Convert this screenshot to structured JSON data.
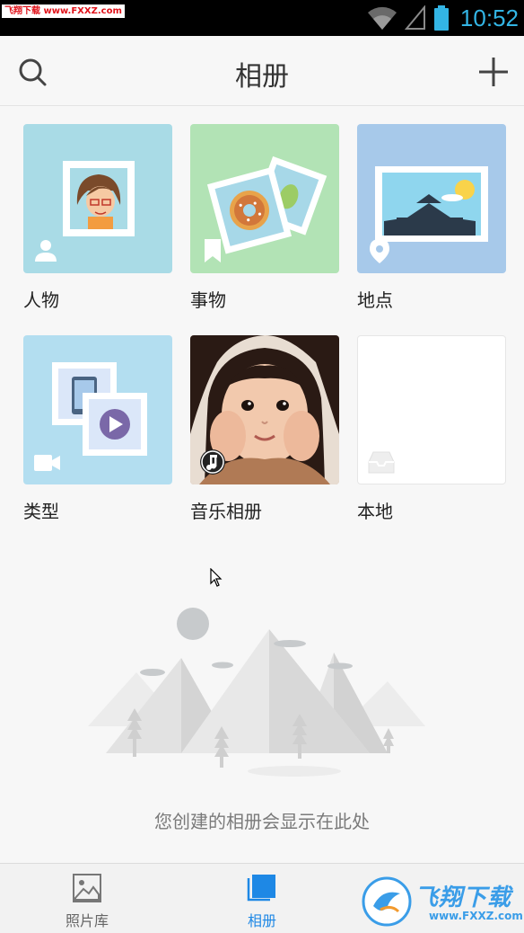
{
  "status_bar": {
    "watermark": "飞翔下载 www.FXXZ.com",
    "time": "10:52",
    "icons": [
      "wifi-icon",
      "signal-icon",
      "battery-icon"
    ]
  },
  "header": {
    "title": "相册",
    "search_icon": "search-icon",
    "add_icon": "plus-icon"
  },
  "albums": [
    {
      "label": "人物",
      "bg": "#a9dbe6",
      "badge_icon": "person-icon"
    },
    {
      "label": "事物",
      "bg": "#b2e3b5",
      "badge_icon": "bookmark-icon"
    },
    {
      "label": "地点",
      "bg": "#a7c9ea",
      "badge_icon": "location-pin-icon"
    },
    {
      "label": "类型",
      "bg": "#b3def0",
      "badge_icon": "video-camera-icon"
    },
    {
      "label": "音乐相册",
      "bg": "#caa98e",
      "badge_icon": "music-note-icon"
    },
    {
      "label": "本地",
      "bg": "#ffffff",
      "badge_icon": "inbox-icon"
    }
  ],
  "empty_state": {
    "text": "您创建的相册会显示在此处"
  },
  "bottom_nav": {
    "items": [
      {
        "label": "照片库",
        "icon": "image-icon",
        "active": false
      },
      {
        "label": "相册",
        "icon": "album-stack-icon",
        "active": true
      }
    ]
  },
  "watermark_bottom": {
    "text": "飞翔下载",
    "sub": "www.FXXZ.com"
  },
  "colors": {
    "accent": "#1e88e5",
    "clock": "#33b5e5"
  }
}
